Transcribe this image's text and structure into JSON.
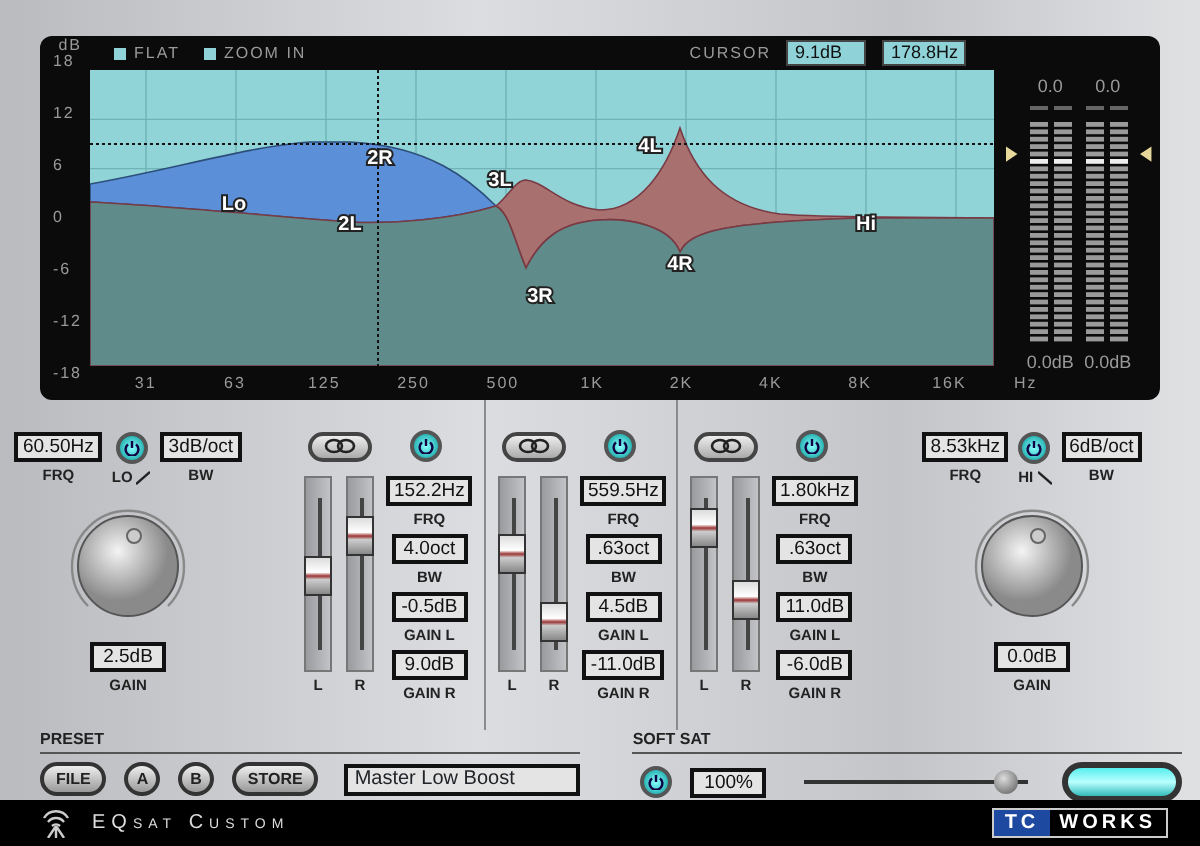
{
  "display": {
    "legend": [
      {
        "label": "FLAT"
      },
      {
        "label": "ZOOM IN"
      }
    ],
    "cursor": {
      "label": "CURSOR",
      "gain": "9.1dB",
      "freq": "178.8Hz"
    },
    "y_unit": "dB",
    "y_ticks": [
      "18",
      "12",
      "6",
      "0",
      "-6",
      "-12",
      "-18"
    ],
    "x_ticks": [
      "31",
      "63",
      "125",
      "250",
      "500",
      "1K",
      "2K",
      "4K",
      "8K",
      "16K"
    ],
    "x_unit": "Hz",
    "curve_labels": [
      "Lo",
      "2R",
      "2L",
      "3L",
      "3R",
      "4L",
      "4R",
      "Hi"
    ],
    "meters": [
      {
        "peak": "0.0",
        "reading": "0.0dB"
      },
      {
        "peak": "0.0",
        "reading": "0.0dB"
      }
    ]
  },
  "lo_shelf": {
    "kind": "low",
    "on": true,
    "name": "LO",
    "freq": {
      "value": "60.50Hz",
      "label": "FRQ"
    },
    "slope": {
      "value": "3dB/oct",
      "label": "BW"
    },
    "gain": {
      "value": "2.5dB",
      "label": "GAIN"
    }
  },
  "bands": [
    {
      "on": true,
      "fields": [
        {
          "value": "152.2Hz",
          "label": "FRQ"
        },
        {
          "value": "4.0oct",
          "label": "BW"
        },
        {
          "value": "-0.5dB",
          "label": "GAIN L"
        },
        {
          "value": "9.0dB",
          "label": "GAIN R"
        }
      ],
      "faders": [
        {
          "label": "L",
          "level": 0.49
        },
        {
          "label": "R",
          "level": 0.75
        }
      ]
    },
    {
      "on": true,
      "fields": [
        {
          "value": "559.5Hz",
          "label": "FRQ"
        },
        {
          "value": ".63oct",
          "label": "BW"
        },
        {
          "value": "4.5dB",
          "label": "GAIN L"
        },
        {
          "value": "-11.0dB",
          "label": "GAIN R"
        }
      ],
      "faders": [
        {
          "label": "L",
          "level": 0.63
        },
        {
          "label": "R",
          "level": 0.19
        }
      ]
    },
    {
      "on": true,
      "fields": [
        {
          "value": "1.80kHz",
          "label": "FRQ"
        },
        {
          "value": ".63oct",
          "label": "BW"
        },
        {
          "value": "11.0dB",
          "label": "GAIN L"
        },
        {
          "value": "-6.0dB",
          "label": "GAIN R"
        }
      ],
      "faders": [
        {
          "label": "L",
          "level": 0.8
        },
        {
          "label": "R",
          "level": 0.33
        }
      ]
    }
  ],
  "hi_shelf": {
    "kind": "high",
    "on": true,
    "name": "HI",
    "freq": {
      "value": "8.53kHz",
      "label": "FRQ"
    },
    "slope": {
      "value": "6dB/oct",
      "label": "BW"
    },
    "gain": {
      "value": "0.0dB",
      "label": "GAIN"
    }
  },
  "preset": {
    "label": "PRESET",
    "buttons": [
      "FILE",
      "A",
      "B",
      "STORE"
    ],
    "name": "Master Low Boost"
  },
  "soft_sat": {
    "label": "SOFT SAT",
    "on": true,
    "value": "100%",
    "level": 0.95
  },
  "output_lamp": {
    "on": true
  },
  "footer": {
    "product": "EQsat Custom",
    "brand_left": "TC",
    "brand_right": "WORKS"
  }
}
